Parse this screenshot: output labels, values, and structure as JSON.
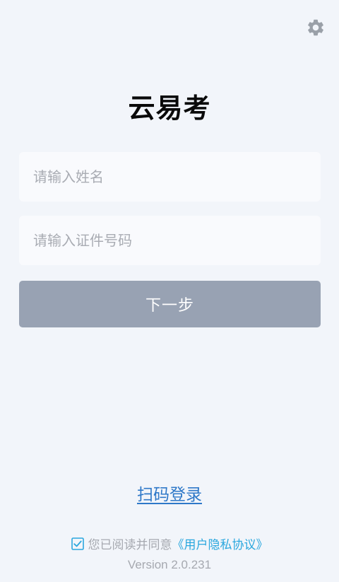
{
  "header": {
    "settings_icon": "gear-icon"
  },
  "app": {
    "title": "云易考"
  },
  "form": {
    "name_placeholder": "请输入姓名",
    "id_placeholder": "请输入证件号码",
    "next_label": "下一步"
  },
  "footer": {
    "scan_login_label": "扫码登录",
    "agreement_checked": true,
    "agreement_text": "您已阅读并同意",
    "policy_link": "《用户隐私协议》",
    "version": "Version 2.0.231"
  },
  "colors": {
    "background": "#f2f5fa",
    "button_disabled": "#98a2b3",
    "link_blue": "#2e78c8",
    "policy_blue": "#2aa7de",
    "muted_text": "#a6a9b0"
  }
}
